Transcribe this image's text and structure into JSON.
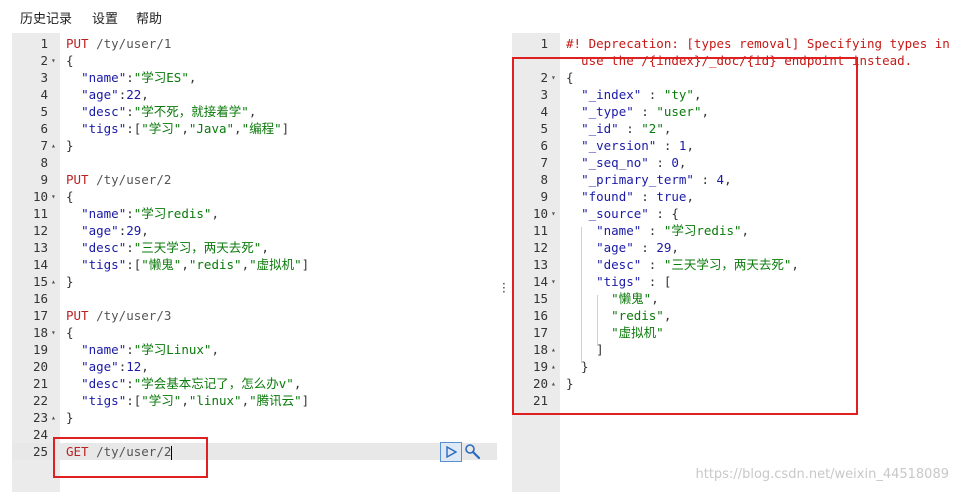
{
  "menu": {
    "history": "历史记录",
    "settings": "设置",
    "help": "帮助"
  },
  "left_lines": [
    {
      "n": "1",
      "fold": "",
      "tokens": [
        [
          "m",
          "PUT "
        ],
        [
          "u",
          "/ty/user/1"
        ]
      ]
    },
    {
      "n": "2",
      "fold": "▾",
      "tokens": [
        [
          "p",
          "{"
        ]
      ]
    },
    {
      "n": "3",
      "fold": "",
      "tokens": [
        [
          "p",
          "  "
        ],
        [
          "k",
          "\"name\""
        ],
        [
          "p",
          ":"
        ],
        [
          "s",
          "\"学习ES\""
        ],
        [
          "p",
          ","
        ]
      ]
    },
    {
      "n": "4",
      "fold": "",
      "tokens": [
        [
          "p",
          "  "
        ],
        [
          "k",
          "\"age\""
        ],
        [
          "p",
          ":"
        ],
        [
          "n",
          "22"
        ],
        [
          "p",
          ","
        ]
      ]
    },
    {
      "n": "5",
      "fold": "",
      "tokens": [
        [
          "p",
          "  "
        ],
        [
          "k",
          "\"desc\""
        ],
        [
          "p",
          ":"
        ],
        [
          "s",
          "\"学不死，就接着学\""
        ],
        [
          "p",
          ","
        ]
      ]
    },
    {
      "n": "6",
      "fold": "",
      "tokens": [
        [
          "p",
          "  "
        ],
        [
          "k",
          "\"tigs\""
        ],
        [
          "p",
          ":["
        ],
        [
          "s",
          "\"学习\""
        ],
        [
          "p",
          ","
        ],
        [
          "s",
          "\"Java\""
        ],
        [
          "p",
          ","
        ],
        [
          "s",
          "\"编程\""
        ],
        [
          "p",
          "]"
        ]
      ]
    },
    {
      "n": "7",
      "fold": "▴",
      "tokens": [
        [
          "p",
          "}"
        ]
      ]
    },
    {
      "n": "8",
      "fold": "",
      "tokens": []
    },
    {
      "n": "9",
      "fold": "",
      "tokens": [
        [
          "m",
          "PUT "
        ],
        [
          "u",
          "/ty/user/2"
        ]
      ]
    },
    {
      "n": "10",
      "fold": "▾",
      "tokens": [
        [
          "p",
          "{"
        ]
      ]
    },
    {
      "n": "11",
      "fold": "",
      "tokens": [
        [
          "p",
          "  "
        ],
        [
          "k",
          "\"name\""
        ],
        [
          "p",
          ":"
        ],
        [
          "s",
          "\"学习redis\""
        ],
        [
          "p",
          ","
        ]
      ]
    },
    {
      "n": "12",
      "fold": "",
      "tokens": [
        [
          "p",
          "  "
        ],
        [
          "k",
          "\"age\""
        ],
        [
          "p",
          ":"
        ],
        [
          "n",
          "29"
        ],
        [
          "p",
          ","
        ]
      ]
    },
    {
      "n": "13",
      "fold": "",
      "tokens": [
        [
          "p",
          "  "
        ],
        [
          "k",
          "\"desc\""
        ],
        [
          "p",
          ":"
        ],
        [
          "s",
          "\"三天学习，两天去死\""
        ],
        [
          "p",
          ","
        ]
      ]
    },
    {
      "n": "14",
      "fold": "",
      "tokens": [
        [
          "p",
          "  "
        ],
        [
          "k",
          "\"tigs\""
        ],
        [
          "p",
          ":["
        ],
        [
          "s",
          "\"懒鬼\""
        ],
        [
          "p",
          ","
        ],
        [
          "s",
          "\"redis\""
        ],
        [
          "p",
          ","
        ],
        [
          "s",
          "\"虚拟机\""
        ],
        [
          "p",
          "]"
        ]
      ]
    },
    {
      "n": "15",
      "fold": "▴",
      "tokens": [
        [
          "p",
          "}"
        ]
      ]
    },
    {
      "n": "16",
      "fold": "",
      "tokens": []
    },
    {
      "n": "17",
      "fold": "",
      "tokens": [
        [
          "m",
          "PUT "
        ],
        [
          "u",
          "/ty/user/3"
        ]
      ]
    },
    {
      "n": "18",
      "fold": "▾",
      "tokens": [
        [
          "p",
          "{"
        ]
      ]
    },
    {
      "n": "19",
      "fold": "",
      "tokens": [
        [
          "p",
          "  "
        ],
        [
          "k",
          "\"name\""
        ],
        [
          "p",
          ":"
        ],
        [
          "s",
          "\"学习Linux\""
        ],
        [
          "p",
          ","
        ]
      ]
    },
    {
      "n": "20",
      "fold": "",
      "tokens": [
        [
          "p",
          "  "
        ],
        [
          "k",
          "\"age\""
        ],
        [
          "p",
          ":"
        ],
        [
          "n",
          "12"
        ],
        [
          "p",
          ","
        ]
      ]
    },
    {
      "n": "21",
      "fold": "",
      "tokens": [
        [
          "p",
          "  "
        ],
        [
          "k",
          "\"desc\""
        ],
        [
          "p",
          ":"
        ],
        [
          "s",
          "\"学会基本忘记了，怎么办v\""
        ],
        [
          "p",
          ","
        ]
      ]
    },
    {
      "n": "22",
      "fold": "",
      "tokens": [
        [
          "p",
          "  "
        ],
        [
          "k",
          "\"tigs\""
        ],
        [
          "p",
          ":["
        ],
        [
          "s",
          "\"学习\""
        ],
        [
          "p",
          ","
        ],
        [
          "s",
          "\"linux\""
        ],
        [
          "p",
          ","
        ],
        [
          "s",
          "\"腾讯云\""
        ],
        [
          "p",
          "]"
        ]
      ]
    },
    {
      "n": "23",
      "fold": "▴",
      "tokens": [
        [
          "p",
          "}"
        ]
      ]
    },
    {
      "n": "24",
      "fold": "",
      "tokens": []
    },
    {
      "n": "25",
      "fold": "",
      "tokens": [
        [
          "m",
          "GET "
        ],
        [
          "u",
          "/ty/user/2"
        ]
      ]
    }
  ],
  "right_lines": [
    {
      "n": "1",
      "fold": "",
      "tokens": [
        [
          "cm",
          "#! Deprecation: [types removal] Specifying types in"
        ]
      ]
    },
    {
      "n": "",
      "fold": "",
      "tokens": [
        [
          "cm",
          "  use the /{index}/_doc/{id} endpoint instead."
        ]
      ]
    },
    {
      "n": "2",
      "fold": "▾",
      "tokens": [
        [
          "p",
          "{"
        ]
      ]
    },
    {
      "n": "3",
      "fold": "",
      "tokens": [
        [
          "p",
          "  "
        ],
        [
          "k",
          "\"_index\""
        ],
        [
          "p",
          " : "
        ],
        [
          "s",
          "\"ty\""
        ],
        [
          "p",
          ","
        ]
      ]
    },
    {
      "n": "4",
      "fold": "",
      "tokens": [
        [
          "p",
          "  "
        ],
        [
          "k",
          "\"_type\""
        ],
        [
          "p",
          " : "
        ],
        [
          "s",
          "\"user\""
        ],
        [
          "p",
          ","
        ]
      ]
    },
    {
      "n": "5",
      "fold": "",
      "tokens": [
        [
          "p",
          "  "
        ],
        [
          "k",
          "\"_id\""
        ],
        [
          "p",
          " : "
        ],
        [
          "s",
          "\"2\""
        ],
        [
          "p",
          ","
        ]
      ]
    },
    {
      "n": "6",
      "fold": "",
      "tokens": [
        [
          "p",
          "  "
        ],
        [
          "k",
          "\"_version\""
        ],
        [
          "p",
          " : "
        ],
        [
          "n",
          "1"
        ],
        [
          "p",
          ","
        ]
      ]
    },
    {
      "n": "7",
      "fold": "",
      "tokens": [
        [
          "p",
          "  "
        ],
        [
          "k",
          "\"_seq_no\""
        ],
        [
          "p",
          " : "
        ],
        [
          "n",
          "0"
        ],
        [
          "p",
          ","
        ]
      ]
    },
    {
      "n": "8",
      "fold": "",
      "tokens": [
        [
          "p",
          "  "
        ],
        [
          "k",
          "\"_primary_term\""
        ],
        [
          "p",
          " : "
        ],
        [
          "n",
          "4"
        ],
        [
          "p",
          ","
        ]
      ]
    },
    {
      "n": "9",
      "fold": "",
      "tokens": [
        [
          "p",
          "  "
        ],
        [
          "k",
          "\"found\""
        ],
        [
          "p",
          " : "
        ],
        [
          "n",
          "true"
        ],
        [
          "p",
          ","
        ]
      ]
    },
    {
      "n": "10",
      "fold": "▾",
      "tokens": [
        [
          "p",
          "  "
        ],
        [
          "k",
          "\"_source\""
        ],
        [
          "p",
          " : {"
        ]
      ]
    },
    {
      "n": "11",
      "fold": "",
      "tokens": [
        [
          "p",
          "    "
        ],
        [
          "k",
          "\"name\""
        ],
        [
          "p",
          " : "
        ],
        [
          "s",
          "\"学习redis\""
        ],
        [
          "p",
          ","
        ]
      ]
    },
    {
      "n": "12",
      "fold": "",
      "tokens": [
        [
          "p",
          "    "
        ],
        [
          "k",
          "\"age\""
        ],
        [
          "p",
          " : "
        ],
        [
          "n",
          "29"
        ],
        [
          "p",
          ","
        ]
      ]
    },
    {
      "n": "13",
      "fold": "",
      "tokens": [
        [
          "p",
          "    "
        ],
        [
          "k",
          "\"desc\""
        ],
        [
          "p",
          " : "
        ],
        [
          "s",
          "\"三天学习，两天去死\""
        ],
        [
          "p",
          ","
        ]
      ]
    },
    {
      "n": "14",
      "fold": "▾",
      "tokens": [
        [
          "p",
          "    "
        ],
        [
          "k",
          "\"tigs\""
        ],
        [
          "p",
          " : ["
        ]
      ]
    },
    {
      "n": "15",
      "fold": "",
      "tokens": [
        [
          "p",
          "      "
        ],
        [
          "s",
          "\"懒鬼\""
        ],
        [
          "p",
          ","
        ]
      ]
    },
    {
      "n": "16",
      "fold": "",
      "tokens": [
        [
          "p",
          "      "
        ],
        [
          "s",
          "\"redis\""
        ],
        [
          "p",
          ","
        ]
      ]
    },
    {
      "n": "17",
      "fold": "",
      "tokens": [
        [
          "p",
          "      "
        ],
        [
          "s",
          "\"虚拟机\""
        ]
      ]
    },
    {
      "n": "18",
      "fold": "▴",
      "tokens": [
        [
          "p",
          "    ]"
        ]
      ]
    },
    {
      "n": "19",
      "fold": "▴",
      "tokens": [
        [
          "p",
          "  }"
        ]
      ]
    },
    {
      "n": "20",
      "fold": "▴",
      "tokens": [
        [
          "p",
          "}"
        ]
      ]
    },
    {
      "n": "21",
      "fold": "",
      "tokens": []
    }
  ],
  "watermark": "https://blog.csdn.net/weixin_44518089",
  "colors": {
    "highlight_box": "#e02020",
    "active_line": "#e8e8e8"
  }
}
